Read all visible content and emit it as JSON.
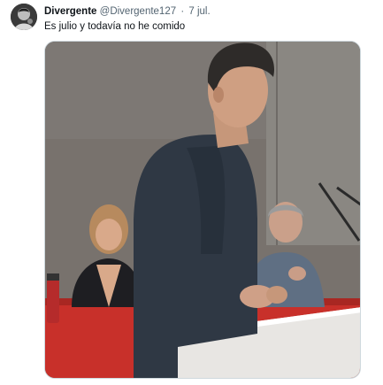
{
  "tweet": {
    "display_name": "Divergente",
    "handle": "@Divergente127",
    "separator": "·",
    "date": "7 jul.",
    "text": "Es julio y todavía no he comido"
  },
  "icons": {
    "avatar": "profile-avatar"
  },
  "colors": {
    "name": "#0f1419",
    "meta": "#536471",
    "border": "#cfd9de"
  }
}
